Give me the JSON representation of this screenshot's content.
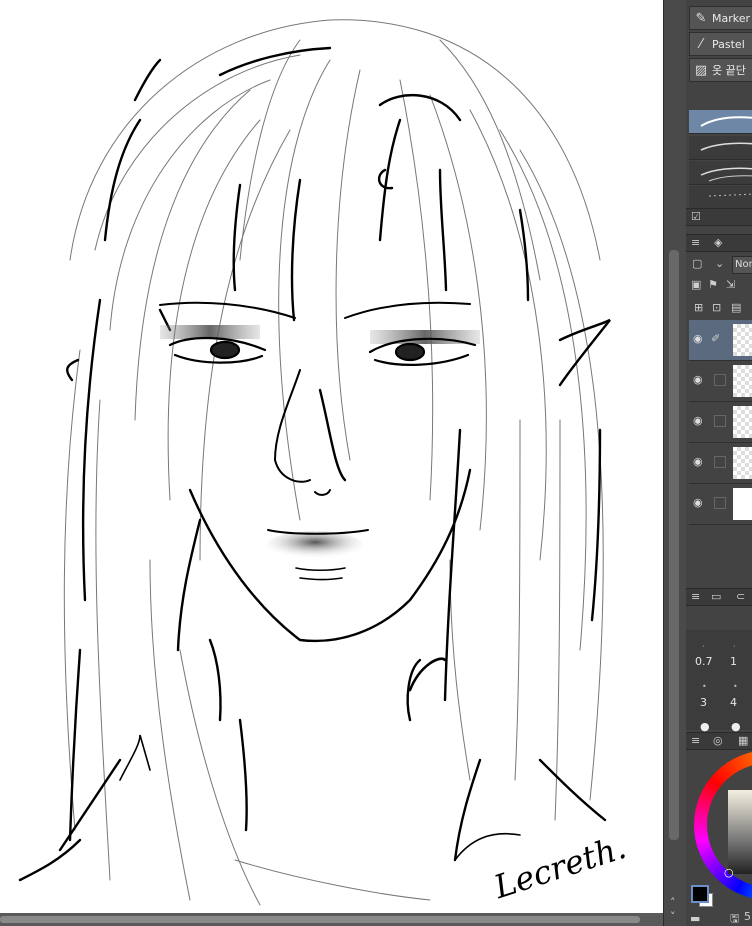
{
  "brush_list": {
    "items": [
      {
        "label": "Marker",
        "icon": "marker-pen-icon"
      },
      {
        "label": "Pastel",
        "icon": "pastel-icon"
      },
      {
        "label": "옷 끝단 ",
        "icon": "hatching-brush-icon"
      }
    ]
  },
  "layer_panel": {
    "blend_mode": "Norm"
  },
  "brush_size_palette": {
    "sizes": [
      "0.7",
      "1",
      "3",
      "4"
    ]
  },
  "status_bar": {
    "value": "5"
  },
  "canvas": {
    "signature": "Lecreth."
  },
  "colors": {
    "panel_bg": "#434343",
    "selection": "#6e87a6",
    "foreground": "#000000",
    "background": "#ffffff"
  }
}
